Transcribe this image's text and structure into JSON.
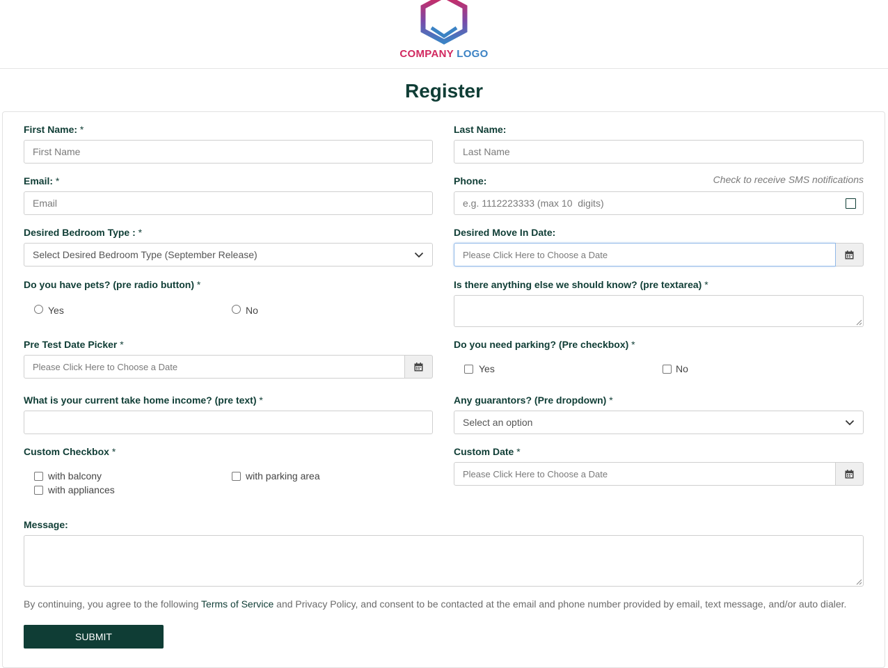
{
  "logo": {
    "word1": "COMPANY",
    "word2": "LOGO",
    "icon": "hexagon-logo-icon"
  },
  "page_title": "Register",
  "form": {
    "first_name": {
      "label": "First Name:",
      "required": "*",
      "placeholder": "First Name"
    },
    "last_name": {
      "label": "Last Name:",
      "placeholder": "Last Name"
    },
    "email": {
      "label": "Email:",
      "required": "*",
      "placeholder": "Email"
    },
    "phone": {
      "label": "Phone:",
      "placeholder": "e.g. 1112223333 (max 10  digits)",
      "sms_hint": "Check to receive SMS notifications",
      "sms_checked": false
    },
    "bedroom": {
      "label": "Desired Bedroom Type :",
      "required": "*",
      "selected": "Select Desired Bedroom Type (September Release)"
    },
    "move_in": {
      "label": "Desired Move In Date:",
      "placeholder": "Please Click Here to Choose a Date"
    },
    "pets": {
      "label": "Do you have pets? (pre radio button)",
      "required": "*",
      "options": [
        "Yes",
        "No"
      ]
    },
    "anything_else": {
      "label": "Is there anything else we should know? (pre textarea)",
      "required": "*"
    },
    "pre_test_date": {
      "label": "Pre Test Date Picker",
      "required": "*",
      "placeholder": "Please Click Here to Choose a Date"
    },
    "parking": {
      "label": "Do you need parking? (Pre checkbox)",
      "required": "*",
      "options": [
        "Yes",
        "No"
      ]
    },
    "income": {
      "label": "What is your current take home income? (pre text)",
      "required": "*"
    },
    "guarantors": {
      "label": "Any guarantors? (Pre dropdown)",
      "required": "*",
      "selected": "Select an option"
    },
    "custom_checkbox": {
      "label": "Custom Checkbox",
      "required": "*",
      "options": [
        "with balcony",
        "with parking area",
        "with appliances"
      ]
    },
    "custom_date": {
      "label": "Custom Date",
      "required": "*",
      "placeholder": "Please Click Here to Choose a Date"
    },
    "message": {
      "label": "Message:"
    }
  },
  "disclaimer": {
    "part1": "By continuing, you agree to the following ",
    "terms": "Terms of Service",
    "part2": " and Privacy Policy, and consent to be contacted at the email and phone number provided by email, text message, and/or auto dialer."
  },
  "submit_label": "SUBMIT",
  "colors": {
    "primary": "#0f3d35",
    "logo_pink": "#d1285f",
    "logo_blue": "#3b82c4"
  }
}
